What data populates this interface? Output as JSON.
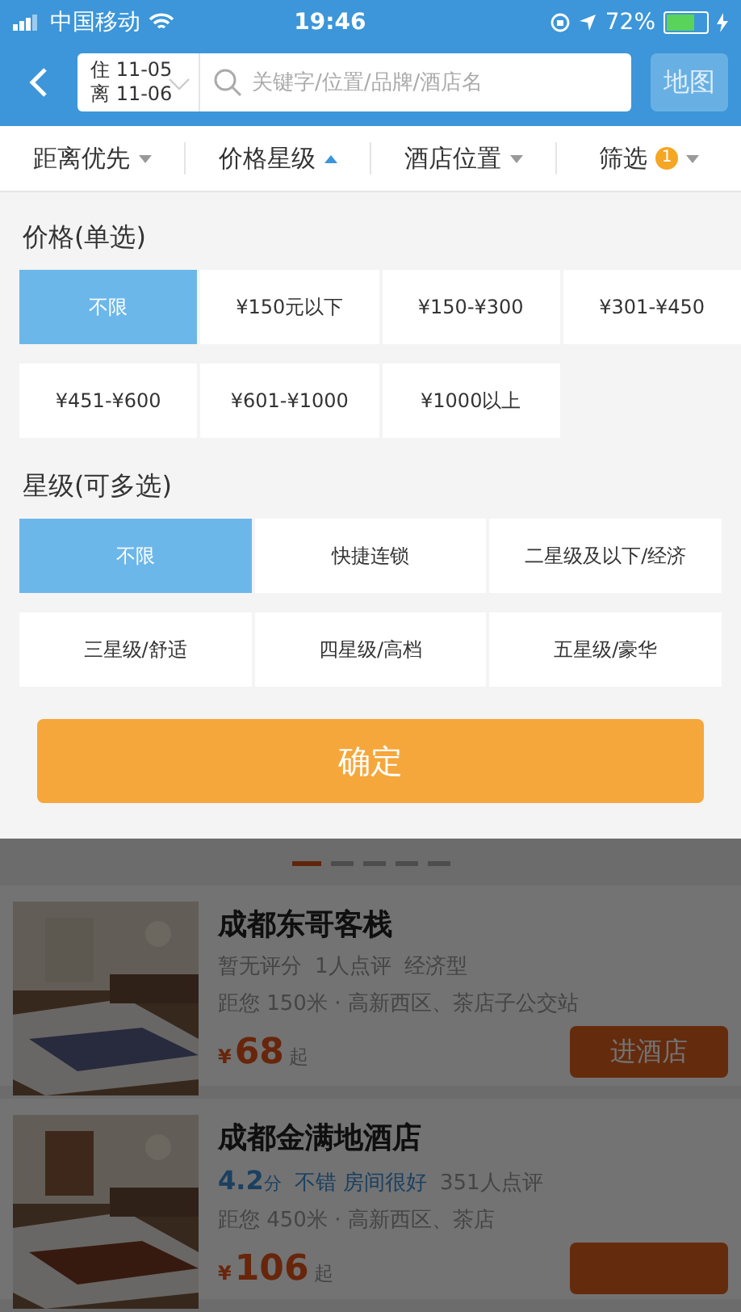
{
  "status_bar": {
    "carrier": "中国移动",
    "time": "19:46",
    "battery": "72%"
  },
  "header": {
    "checkin": "住 11-05",
    "checkout": "离 11-06",
    "search": {
      "placeholder": "关键字/位置/品牌/酒店名"
    },
    "map_button": "地图"
  },
  "sort_tabs": [
    {
      "label": "距离优先",
      "selected": false
    },
    {
      "label": "价格星级",
      "selected": true
    },
    {
      "label": "酒店位置",
      "selected": false
    },
    {
      "label": "筛选",
      "selected": false,
      "badge": "1"
    }
  ],
  "price_section": {
    "title": "价格(单选)",
    "options": [
      {
        "label": "不限",
        "selected": true
      },
      {
        "label": "¥150元以下",
        "selected": false
      },
      {
        "label": "¥150-¥300",
        "selected": false
      },
      {
        "label": "¥301-¥450",
        "selected": false
      },
      {
        "label": "¥451-¥600",
        "selected": false
      },
      {
        "label": "¥601-¥1000",
        "selected": false
      },
      {
        "label": "¥1000以上",
        "selected": false
      }
    ]
  },
  "star_section": {
    "title": "星级(可多选)",
    "options": [
      {
        "label": "不限",
        "selected": true
      },
      {
        "label": "快捷连锁",
        "selected": false
      },
      {
        "label": "二星级及以下/经济",
        "selected": false
      },
      {
        "label": "三星级/舒适",
        "selected": false
      },
      {
        "label": "四星级/高档",
        "selected": false
      },
      {
        "label": "五星级/豪华",
        "selected": false
      }
    ]
  },
  "confirm_button": "确定",
  "banner_dots": [
    {
      "selected": true
    },
    {
      "selected": false
    },
    {
      "selected": false
    },
    {
      "selected": false
    },
    {
      "selected": false
    }
  ],
  "hotels": [
    {
      "name": "成都东哥客栈",
      "review_parts": [
        "暂无评分",
        "1人点评",
        "经济型"
      ],
      "distance": "距您 150米 · 高新西区、茶店子公交站",
      "currency": "¥",
      "price": "68",
      "price_suffix": "起",
      "button": "进酒店"
    },
    {
      "name": "成都金满地酒店",
      "rating_score": "4.2",
      "rating_unit": "分",
      "rating_text": "不错 房间很好",
      "review_parts": [
        "351人点评"
      ],
      "distance": "距您 450米 · 高新西区、茶店",
      "currency": "¥",
      "price": "106",
      "price_suffix": "起"
    }
  ]
}
